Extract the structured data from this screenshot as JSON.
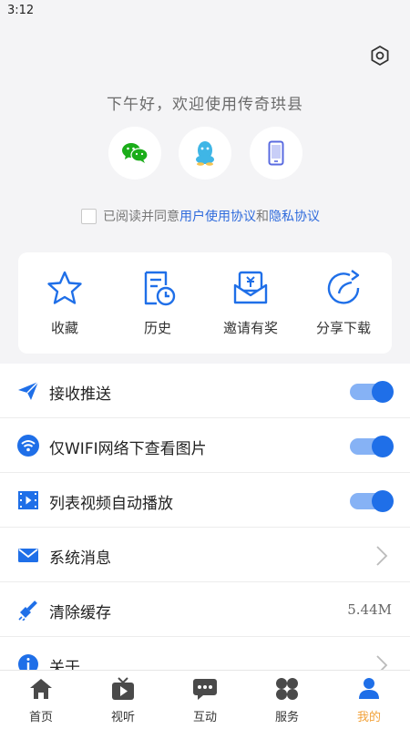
{
  "status_bar": {
    "time": "3:12"
  },
  "header": {
    "greeting": "下午好，欢迎使用传奇珙县"
  },
  "login": {
    "options": [
      "wechat-login",
      "qq-login",
      "phone-login"
    ]
  },
  "agreement": {
    "prefix": "已阅读并同意",
    "user_agreement": "用户使用协议",
    "and": "和",
    "privacy_policy": "隐私协议",
    "checked": false
  },
  "quick_actions": [
    {
      "label": "收藏",
      "icon": "star-icon"
    },
    {
      "label": "历史",
      "icon": "history-icon"
    },
    {
      "label": "邀请有奖",
      "icon": "invite-reward-icon"
    },
    {
      "label": "分享下载",
      "icon": "share-icon"
    }
  ],
  "settings": [
    {
      "label": "接收推送",
      "icon": "send-icon",
      "type": "toggle",
      "on": true
    },
    {
      "label": "仅WIFI网络下查看图片",
      "icon": "wifi-icon",
      "type": "toggle",
      "on": true
    },
    {
      "label": "列表视频自动播放",
      "icon": "video-icon",
      "type": "toggle",
      "on": true
    },
    {
      "label": "系统消息",
      "icon": "mail-icon",
      "type": "chevron"
    },
    {
      "label": "清除缓存",
      "icon": "broom-icon",
      "type": "value",
      "value": "5.44M"
    },
    {
      "label": "关于",
      "icon": "info-icon",
      "type": "chevron"
    }
  ],
  "tabs": [
    {
      "label": "首页",
      "icon": "home-icon"
    },
    {
      "label": "视听",
      "icon": "tv-icon"
    },
    {
      "label": "互动",
      "icon": "chat-icon"
    },
    {
      "label": "服务",
      "icon": "grid-icon"
    },
    {
      "label": "我的",
      "icon": "user-icon",
      "active": true
    }
  ],
  "colors": {
    "accent": "#1f6fe8",
    "link": "#2f6bdc",
    "active_tab": "#f2a23a",
    "background": "#f4f4f6"
  }
}
